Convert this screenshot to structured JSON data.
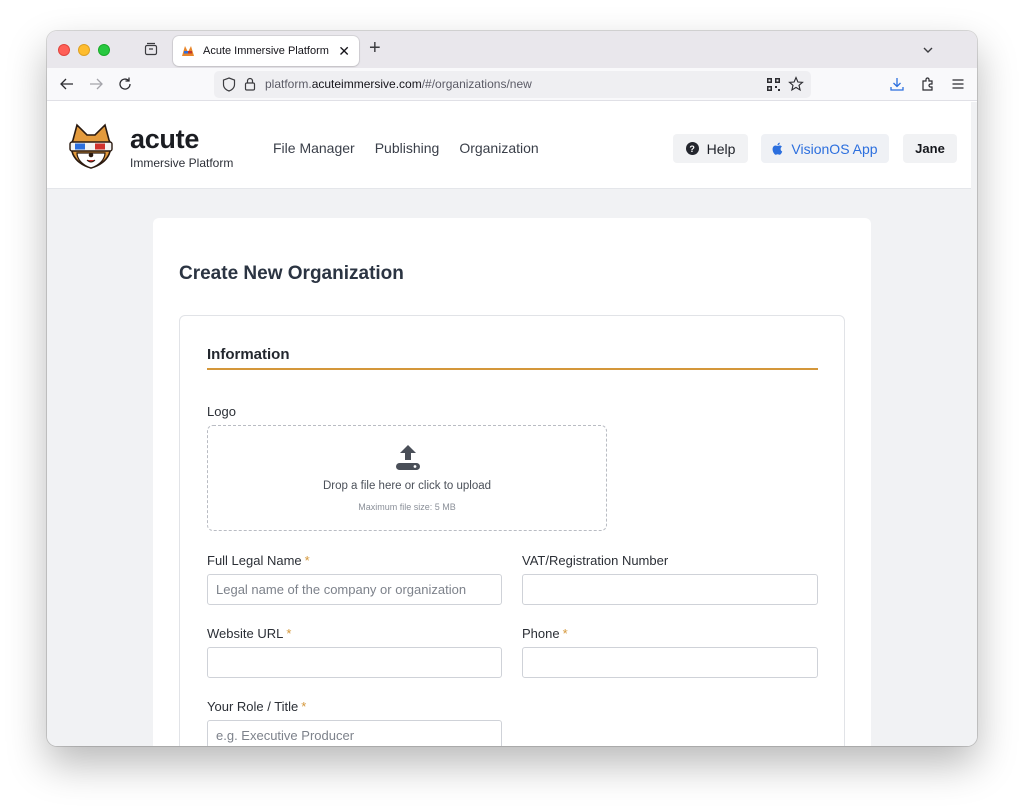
{
  "browser": {
    "tab_title": "Acute Immersive Platform",
    "tab_close": "✕",
    "new_tab": "+",
    "url_prefix": "platform.",
    "url_host": "acuteimmersive.com",
    "url_path": "/#/organizations/new"
  },
  "header": {
    "brand_name": "acute",
    "brand_sub": "Immersive Platform",
    "nav": [
      "File Manager",
      "Publishing",
      "Organization"
    ],
    "help_label": "Help",
    "visionos_label": "VisionOS App",
    "user_label": "Jane"
  },
  "page": {
    "title": "Create New Organization",
    "section_title": "Information",
    "logo_label": "Logo",
    "dropzone_text": "Drop a file here or click to upload",
    "dropzone_hint": "Maximum file size: 5 MB",
    "fields": {
      "legal_name": {
        "label": "Full Legal Name",
        "required": "*",
        "placeholder": "Legal name of the company or organization",
        "value": ""
      },
      "vat": {
        "label": "VAT/Registration Number",
        "placeholder": "",
        "value": ""
      },
      "website": {
        "label": "Website URL",
        "required": "*",
        "placeholder": "",
        "value": ""
      },
      "phone": {
        "label": "Phone",
        "required": "*",
        "placeholder": "",
        "value": ""
      },
      "role": {
        "label": "Your Role / Title",
        "required": "*",
        "placeholder": "e.g. Executive Producer",
        "value": ""
      }
    }
  },
  "colors": {
    "accent": "#d4973a",
    "link_blue": "#2c6fde",
    "page_bg": "#f1f2f4"
  },
  "icons": {
    "back": "arrow-left-icon",
    "forward": "arrow-right-icon",
    "reload": "reload-icon",
    "shield": "tracking-shield-icon",
    "lock": "lock-icon",
    "qr": "qr-code-icon",
    "bookmark": "star-icon",
    "downloads": "download-icon",
    "extensions": "extensions-icon",
    "menu": "hamburger-menu-icon",
    "upload": "upload-icon",
    "apple": "apple-icon",
    "help": "question-circle-icon"
  }
}
